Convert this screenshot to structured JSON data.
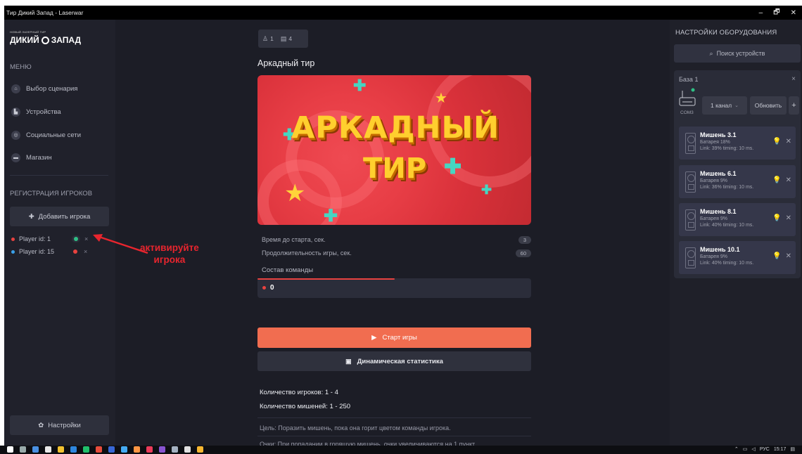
{
  "window": {
    "title": "Тир Дикий Запад - Laserwar",
    "controls": [
      "–",
      "🗗",
      "✕"
    ]
  },
  "logo": {
    "small": "НОВЫЙ ЛАЗЕРНЫЙ ТИР",
    "text": "ДИКИЙ",
    "text2": "ЗАПАД"
  },
  "sidebar": {
    "menu_title": "МЕНЮ",
    "menu": [
      {
        "label": "Выбор сценария",
        "icon": "home-icon",
        "glyph": "⌂"
      },
      {
        "label": "Устройства",
        "icon": "devices-icon",
        "glyph": "▙"
      },
      {
        "label": "Социальные сети",
        "icon": "social-icon",
        "glyph": "◎"
      },
      {
        "label": "Магазин",
        "icon": "shop-icon",
        "glyph": "▬"
      }
    ],
    "registration_title": "РЕГИСТРАЦИЯ ИГРОКОВ",
    "add_player": "Добавить игрока",
    "players": [
      {
        "label": "Player id: 1",
        "color": "#e8423f",
        "toggle_color": "#2fbf85"
      },
      {
        "label": "Player id: 15",
        "color": "#3aa0e8",
        "toggle_color": "#e8423f"
      }
    ],
    "settings": "Настройки"
  },
  "annotation": {
    "line1": "активируйте",
    "line2": "игрока",
    "color": "#e8252e"
  },
  "main": {
    "badge_players": "1",
    "badge_targets": "4",
    "title": "Аркадный тир",
    "banner": {
      "line1": "АРКАДНЫЙ",
      "line2": "ТИР"
    },
    "params": [
      {
        "label": "Время до старта, сек.",
        "value": "3"
      },
      {
        "label": "Продолжительность игры, сек.",
        "value": "60"
      }
    ],
    "team_label": "Состав команды",
    "team_count": "0",
    "team_progress": 0.5,
    "start_button": "Старт игры",
    "stats_button": "Динамическая статистика",
    "players_count": "Количество игроков: 1 - 4",
    "targets_count": "Количество мишеней: 1 - 250",
    "goal": "Цель: Поразить мишень, пока она горит цветом команды игрока.",
    "points": "Очки: При попадании в горящую мишень, очки увеличиваются на 1 пункт."
  },
  "equipment": {
    "title": "НАСТРОЙКИ ОБОРУДОВАНИЯ",
    "search": "Поиск устройств",
    "base": {
      "name": "База 1",
      "port": "COM3",
      "channel": "1 канал",
      "refresh": "Обновить",
      "add": "+"
    },
    "targets": [
      {
        "name": "Мишень 3.1",
        "battery": "Батарея 18%",
        "link": "Link: 39% timing: 10 ms."
      },
      {
        "name": "Мишень 6.1",
        "battery": "Батарея 9%",
        "link": "Link: 36% timing: 10 ms."
      },
      {
        "name": "Мишень 8.1",
        "battery": "Батарея 9%",
        "link": "Link: 40% timing: 10 ms."
      },
      {
        "name": "Мишень 10.1",
        "battery": "Батарея 9%",
        "link": "Link: 40% timing: 10 ms."
      }
    ]
  },
  "taskbar": {
    "lang": "РУС",
    "time": "15:17"
  }
}
